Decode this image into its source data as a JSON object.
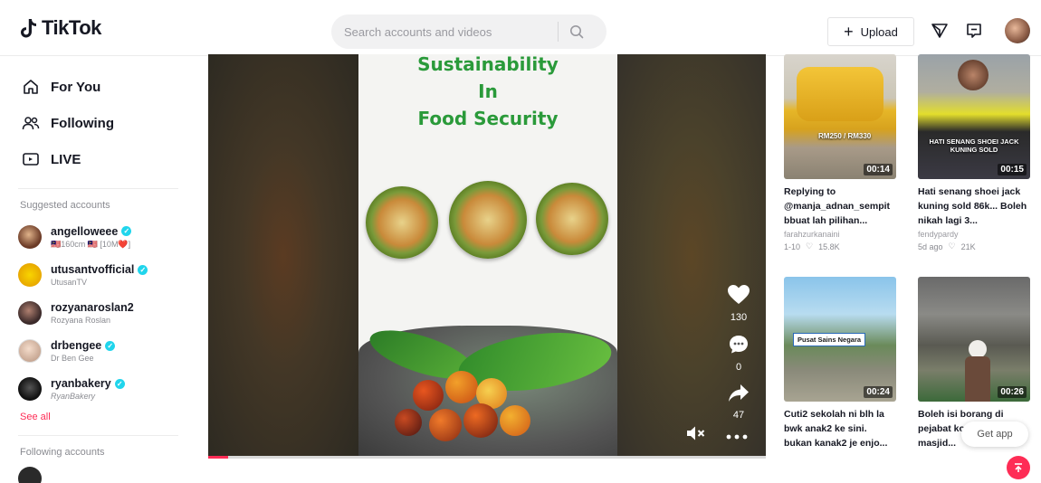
{
  "header": {
    "logo_text": "TikTok",
    "search_placeholder": "Search accounts and videos",
    "upload_label": "Upload"
  },
  "sidebar": {
    "nav": [
      {
        "label": "For You",
        "icon": "home-icon"
      },
      {
        "label": "Following",
        "icon": "people-icon"
      },
      {
        "label": "LIVE",
        "icon": "live-icon"
      }
    ],
    "suggested_title": "Suggested accounts",
    "suggested": [
      {
        "username": "angelloweee",
        "display": "🇲🇾160cm 🇲🇾 [10M❤️]",
        "verified": true,
        "avatar_color": "#6b3a26"
      },
      {
        "username": "utusantvofficial",
        "display": "UtusanTV",
        "verified": true,
        "avatar_color": "#f2c200"
      },
      {
        "username": "rozyanaroslan2",
        "display": "Rozyana Roslan",
        "verified": false,
        "avatar_color": "#3b2a2a"
      },
      {
        "username": "drbengee",
        "display": "Dr Ben Gee",
        "verified": true,
        "avatar_color": "#e9dfd7"
      },
      {
        "username": "ryanbakery",
        "display": "RyanBakery",
        "verified": true,
        "avatar_color": "#1a1a1a"
      }
    ],
    "see_all": "See all",
    "following_title": "Following accounts"
  },
  "video": {
    "title_lines": [
      "Sustainability",
      "In",
      "Food Security"
    ],
    "likes": "130",
    "comments": "0",
    "shares": "47",
    "progress": 0.035,
    "colors": {
      "title": "#2a9a3a",
      "accent": "#fe2c55"
    }
  },
  "related": [
    {
      "title": "Replying to @manja_adnan_sempit bbuat lah pilihan...",
      "author": "farahzurkanaini",
      "time": "1-10",
      "likes": "15.8K",
      "duration": "00:14",
      "overlay": "RM250 / RM330"
    },
    {
      "title": "Hati senang shoei jack kuning sold 86k... Boleh nikah lagi 3...",
      "author": "fendypardy",
      "time": "5d ago",
      "likes": "21K",
      "duration": "00:15",
      "overlay": "HATI SENANG SHOEI JACK KUNING SOLD"
    },
    {
      "title": "Cuti2 sekolah ni blh la bwk anak2 ke sini. bukan kanak2 je enjo...",
      "author": "",
      "time": "",
      "likes": "",
      "duration": "00:24",
      "overlay": "Pusat Sains Negara"
    },
    {
      "title": "Boleh isi borang di pejabat koperasi masjid...",
      "author": "",
      "time": "",
      "likes": "",
      "duration": "00:26",
      "overlay": ""
    }
  ],
  "get_app": "Get app"
}
